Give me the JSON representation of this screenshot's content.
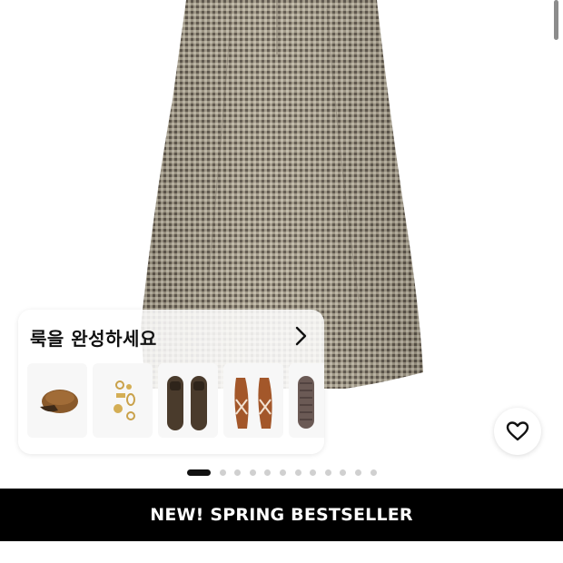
{
  "look": {
    "title": "룩을 완성하세요",
    "arrow_icon": "chevron-right-icon",
    "items": [
      {
        "name": "brown-newsboy-cap",
        "icon": "cap-icon"
      },
      {
        "name": "gold-jewelry-set",
        "icon": "jewelry-icon"
      },
      {
        "name": "brown-loafers",
        "icon": "loafer-icon"
      },
      {
        "name": "tan-heeled-sandals",
        "icon": "sandal-icon"
      },
      {
        "name": "gingham-ballet-flats",
        "icon": "flat-icon"
      }
    ]
  },
  "carousel": {
    "total_slides": 12,
    "active_slide": 1
  },
  "favorite": {
    "icon": "heart-icon"
  },
  "banner": {
    "label": "NEW! SPRING BESTSELLER"
  },
  "colors": {
    "banner_bg": "#000000",
    "banner_text": "#ffffff",
    "dot_active": "#111111",
    "dot_inactive": "#d0d0d0",
    "fabric": "#8b8172"
  }
}
